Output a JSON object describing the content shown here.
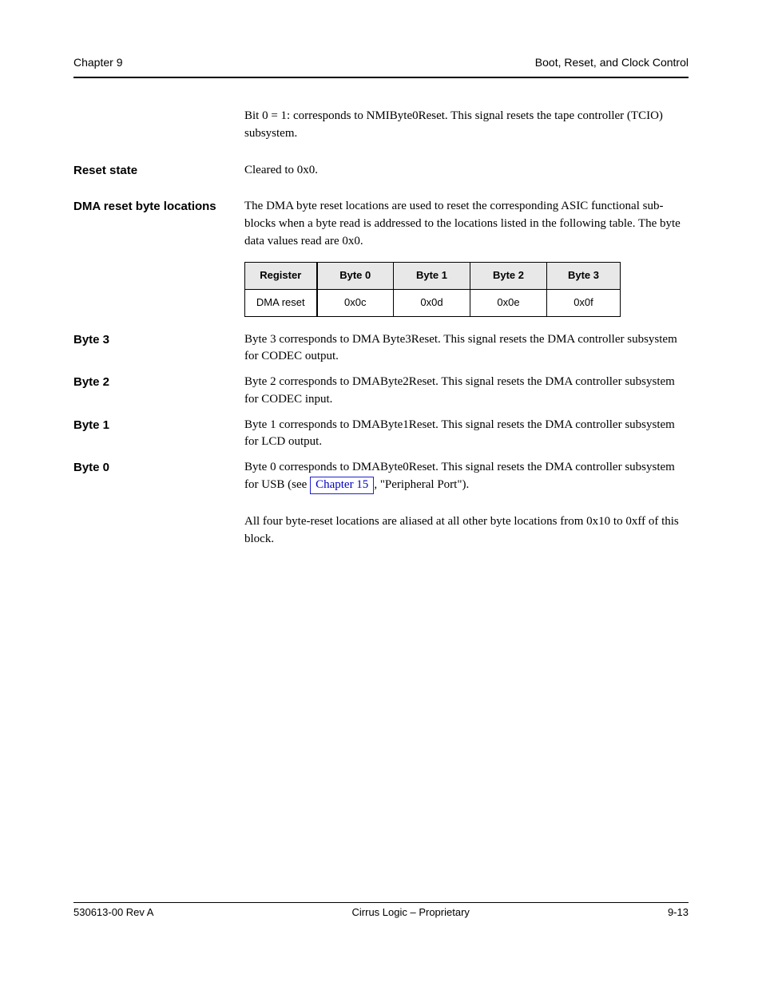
{
  "header": {
    "left": "Chapter 9",
    "right": "Boot, Reset, and Clock Control"
  },
  "rows": [
    {
      "label": "",
      "text": "Bit 0 = 1: corresponds to NMIByte0Reset. This signal resets the tape controller (TCIO) subsystem."
    },
    {
      "label": "Reset state",
      "text": "Cleared to 0x0."
    },
    {
      "label": "DMA reset byte locations",
      "text": "The DMA byte reset locations are used to reset the corresponding ASIC functional sub-blocks when a byte read is addressed to the locations listed in the following table. The byte data values read are 0x0.",
      "pad": true
    }
  ],
  "table": {
    "headers": [
      "Register",
      "Byte 0",
      "Byte 1",
      "Byte 2",
      "Byte 3"
    ],
    "row": [
      "DMA reset",
      "0x0c",
      "0x0d",
      "0x0e",
      "0x0f"
    ]
  },
  "after_table_rows": [
    {
      "label": "Byte 3",
      "text": "Byte 3 corresponds to DMA Byte3Reset. This signal resets the DMA controller subsystem for CODEC output.",
      "indent": true
    },
    {
      "label": "Byte 2",
      "text": "Byte 2 corresponds to DMAByte2Reset. This signal resets the DMA controller subsystem for CODEC input.",
      "indent": true
    },
    {
      "label": "Byte 1",
      "text": "Byte 1 corresponds to DMAByte1Reset. This signal resets the DMA controller subsystem for LCD output.",
      "indent": true
    },
    {
      "label": "Byte 0",
      "text_pre": "Byte 0 corresponds to DMAByte0Reset. This signal resets the DMA controller subsystem for USB (see ",
      "link": "Chapter 15",
      "text_post": ", \"Peripheral Port\").",
      "indent": true
    },
    {
      "label": "",
      "text": "All four byte-reset locations are aliased at all other byte locations from 0x10 to 0xff of this block.",
      "pad": true
    }
  ],
  "footer": {
    "left": "530613-00 Rev A",
    "mid": "Cirrus Logic – Proprietary",
    "right": "9-13"
  }
}
